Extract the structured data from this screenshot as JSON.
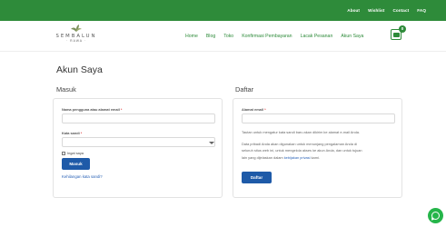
{
  "topbar": {
    "links": [
      "About",
      "Wishlist",
      "Contact",
      "FAQ"
    ]
  },
  "logo": {
    "title": "SEMBALUN",
    "subtitle": "· RAWA ·"
  },
  "nav": {
    "items": [
      "Home",
      "Blog",
      "Toko",
      "Konfirmasi Pembayaran",
      "Lacak Pesanan",
      "Akun Saya"
    ],
    "cart_count": "0"
  },
  "page": {
    "title": "Akun Saya"
  },
  "login": {
    "heading": "Masuk",
    "username_label": "Nama pengguna atau alamat email",
    "required_mark": "*",
    "password_label": "Kata sandi",
    "remember_label": "Ingat saya",
    "submit_label": "Masuk",
    "lost_password": "Kehilangan kata sandi?"
  },
  "register": {
    "heading": "Daftar",
    "email_label": "Alamat email",
    "required_mark": "*",
    "info_line": "Tautan untuk mengatur kata sandi baru akan dikirim ke alamat e-mail Anda.",
    "privacy_text_1": "Data pribadi Anda akan digunakan untuk menunjang pengalaman Anda di",
    "privacy_text_2": "seluruh situs web ini, untuk mengelola akses ke akun Anda, dan untuk tujuan",
    "privacy_text_3": "lain yang dijelaskan dalam",
    "privacy_link": "kebijakan privasi",
    "privacy_text_4": "kami.",
    "submit_label": "Daftar"
  },
  "colors": {
    "brand_green": "#2e8b3a",
    "button_blue": "#1e5aa8",
    "link_blue": "#2b63b7",
    "whatsapp_green": "#25b54a"
  },
  "icons": [
    "leaf-logo-icon",
    "cart-icon",
    "chevron-down-icon",
    "whatsapp-icon"
  ]
}
